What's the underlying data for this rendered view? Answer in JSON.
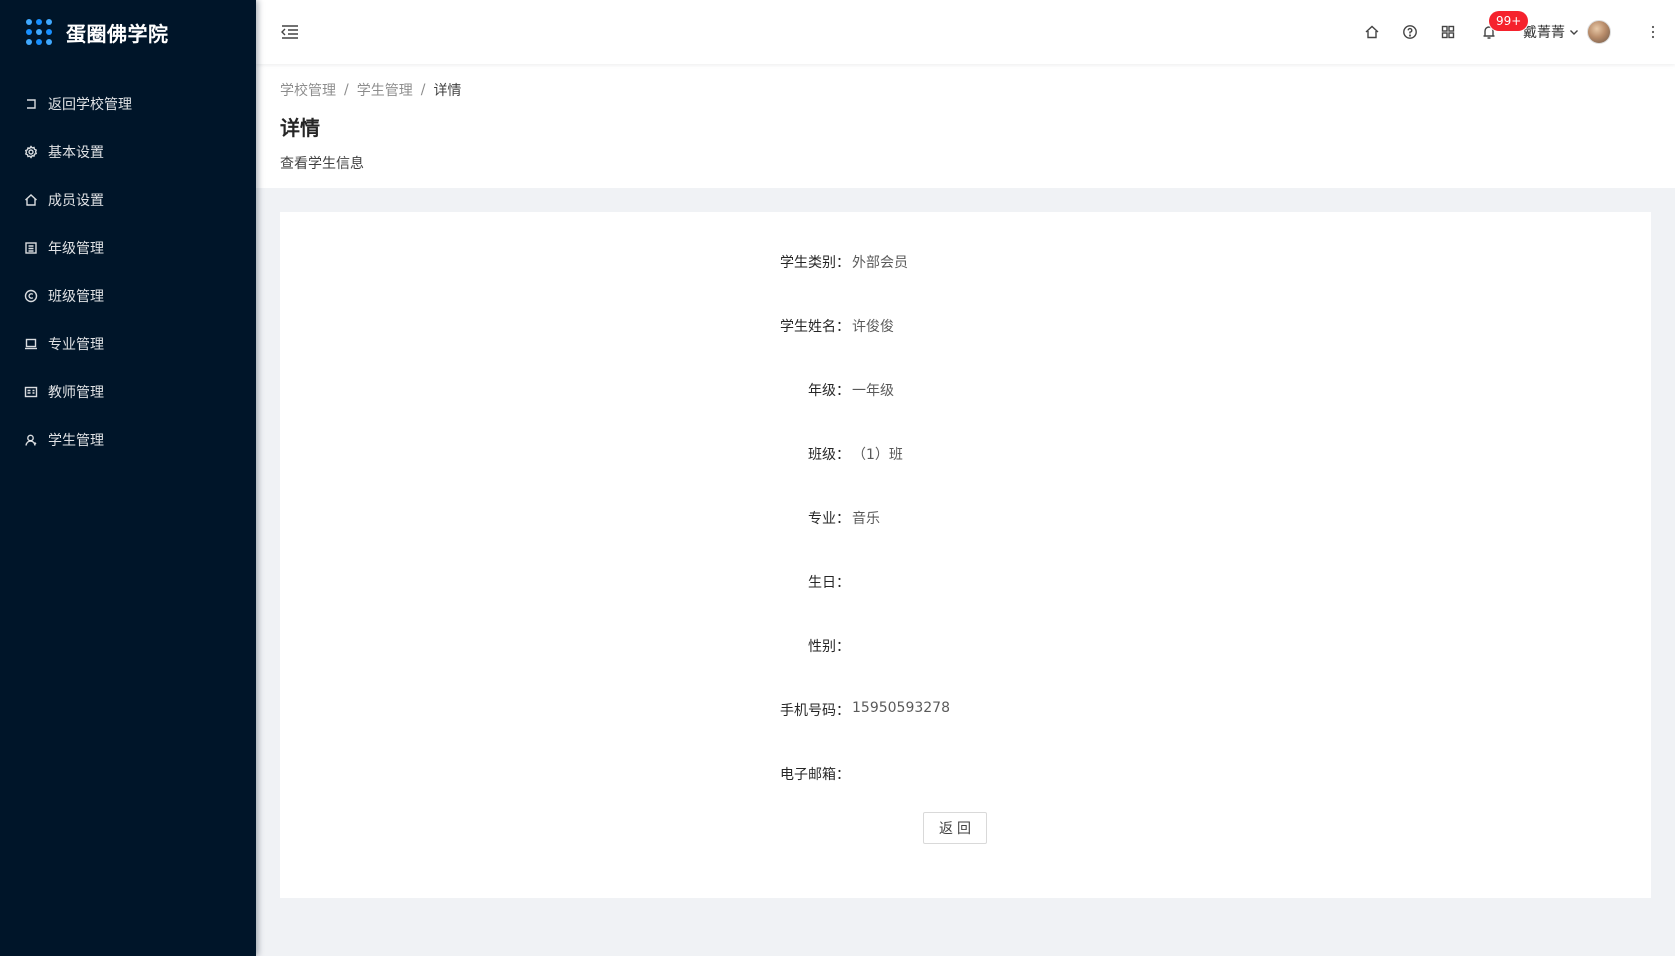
{
  "sidebar": {
    "title": "蛋圈佛学院",
    "items": [
      {
        "label": "返回学校管理",
        "icon": "return-icon"
      },
      {
        "label": "基本设置",
        "icon": "gear-icon"
      },
      {
        "label": "成员设置",
        "icon": "home-icon"
      },
      {
        "label": "年级管理",
        "icon": "calendar-icon"
      },
      {
        "label": "班级管理",
        "icon": "copyright-icon"
      },
      {
        "label": "专业管理",
        "icon": "laptop-icon"
      },
      {
        "label": "教师管理",
        "icon": "id-card-icon"
      },
      {
        "label": "学生管理",
        "icon": "user-icon"
      }
    ]
  },
  "header": {
    "notification_badge": "99+",
    "user_name": "戴菁菁"
  },
  "breadcrumb": {
    "items": [
      "学校管理",
      "学生管理",
      "详情"
    ],
    "separator": "/"
  },
  "page": {
    "title": "详情",
    "description": "查看学生信息"
  },
  "details": [
    {
      "label": "学生类别：",
      "value": "外部会员"
    },
    {
      "label": "学生姓名：",
      "value": "许俊俊"
    },
    {
      "label": "年级：",
      "value": "一年级"
    },
    {
      "label": "班级：",
      "value": "（1）班"
    },
    {
      "label": "专业：",
      "value": "音乐"
    },
    {
      "label": "生日：",
      "value": ""
    },
    {
      "label": "性别：",
      "value": ""
    },
    {
      "label": "手机号码：",
      "value": "15950593278"
    },
    {
      "label": "电子邮箱：",
      "value": ""
    }
  ],
  "actions": {
    "back_label": "返回"
  },
  "colors": {
    "sidebar_bg": "#001529",
    "accent": "#1890ff",
    "badge": "#f5222d",
    "page_bg": "#f0f2f5"
  }
}
